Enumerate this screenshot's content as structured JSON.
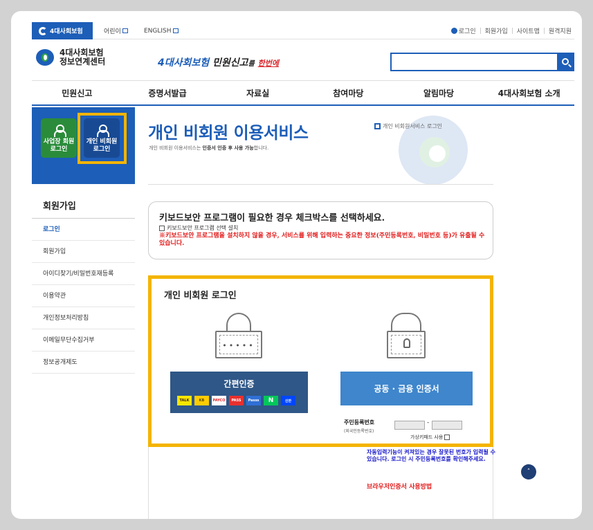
{
  "utilbar": {
    "brand": "4대사회보험",
    "kids": "어린이",
    "english": "ENGLISH",
    "right": [
      "로그인",
      "회원가입",
      "사이트맵",
      "원격지원"
    ]
  },
  "header": {
    "logo_line1": "4대사회보험",
    "logo_line2": "정보연계센터",
    "slogan_blue": "4대사회보험",
    "slogan_dark": "민원신고",
    "slogan_tail": "를",
    "slogan_red": "한번에",
    "search_placeholder": ""
  },
  "gnb": [
    "민원신고",
    "증명서발급",
    "자료실",
    "참여마당",
    "알림마당",
    "4대사회보험 소개"
  ],
  "login_tiles": {
    "business": [
      "사업장 회원",
      "로그인"
    ],
    "individual": [
      "개인 비회원",
      "로그인"
    ]
  },
  "lnb": {
    "title": "회원가입",
    "items": [
      "로그인",
      "회원가입",
      "아이디찾기/비밀번호재등록",
      "이용약관",
      "개인정보처리방침",
      "이메일무단수집거부",
      "정보공개제도"
    ]
  },
  "page": {
    "title": "개인 비회원 이용서비스",
    "subtitle_pre": "개인 비회원 이용서비스는 ",
    "subtitle_bold": "인증서 인증 후 사용 가능",
    "subtitle_post": "합니다.",
    "breadcrumb": "개인 비회원서비스 로그인"
  },
  "keyboard": {
    "heading": "키보드보안 프로그램이 필요한 경우 체크박스를 선택하세요.",
    "checkbox_label": "키보드보안 프로그램 선택 설치",
    "warning": "※키보드보안 프로그램을 설치하지 않을 경우, 서비스를 위해 입력하는 중요한 정보(주민등록번호, 비밀번호 등)가 유출될 수 있습니다."
  },
  "login": {
    "title": "개인 비회원 로그인",
    "lock_dots": "•••••",
    "easy_auth": "간편인증",
    "chips": [
      "TALK",
      "KB",
      "PAYCO",
      "PASS",
      "Passs",
      "N",
      "신한"
    ],
    "cert_auth": "공동 · 금융 인증서",
    "rrn_label": "주민등록번호",
    "rrn_note": "(외국인등록번호)",
    "rrn_dash": "-",
    "virtual_keypad": "가상키패드 사용"
  },
  "auto_note": "자동입력기능이 켜져있는 경우 잘못된 번호가 입력될 수 있습니다. 로그인 시 주민등록번호를 확인해주세요.",
  "browser_link": "브라우저인증서 사용방법",
  "top_button": "˄",
  "colors": {
    "primary": "#1d5eb8",
    "highlight": "#f4b400",
    "warning": "#e21b1b",
    "green": "#2a8c3a"
  }
}
